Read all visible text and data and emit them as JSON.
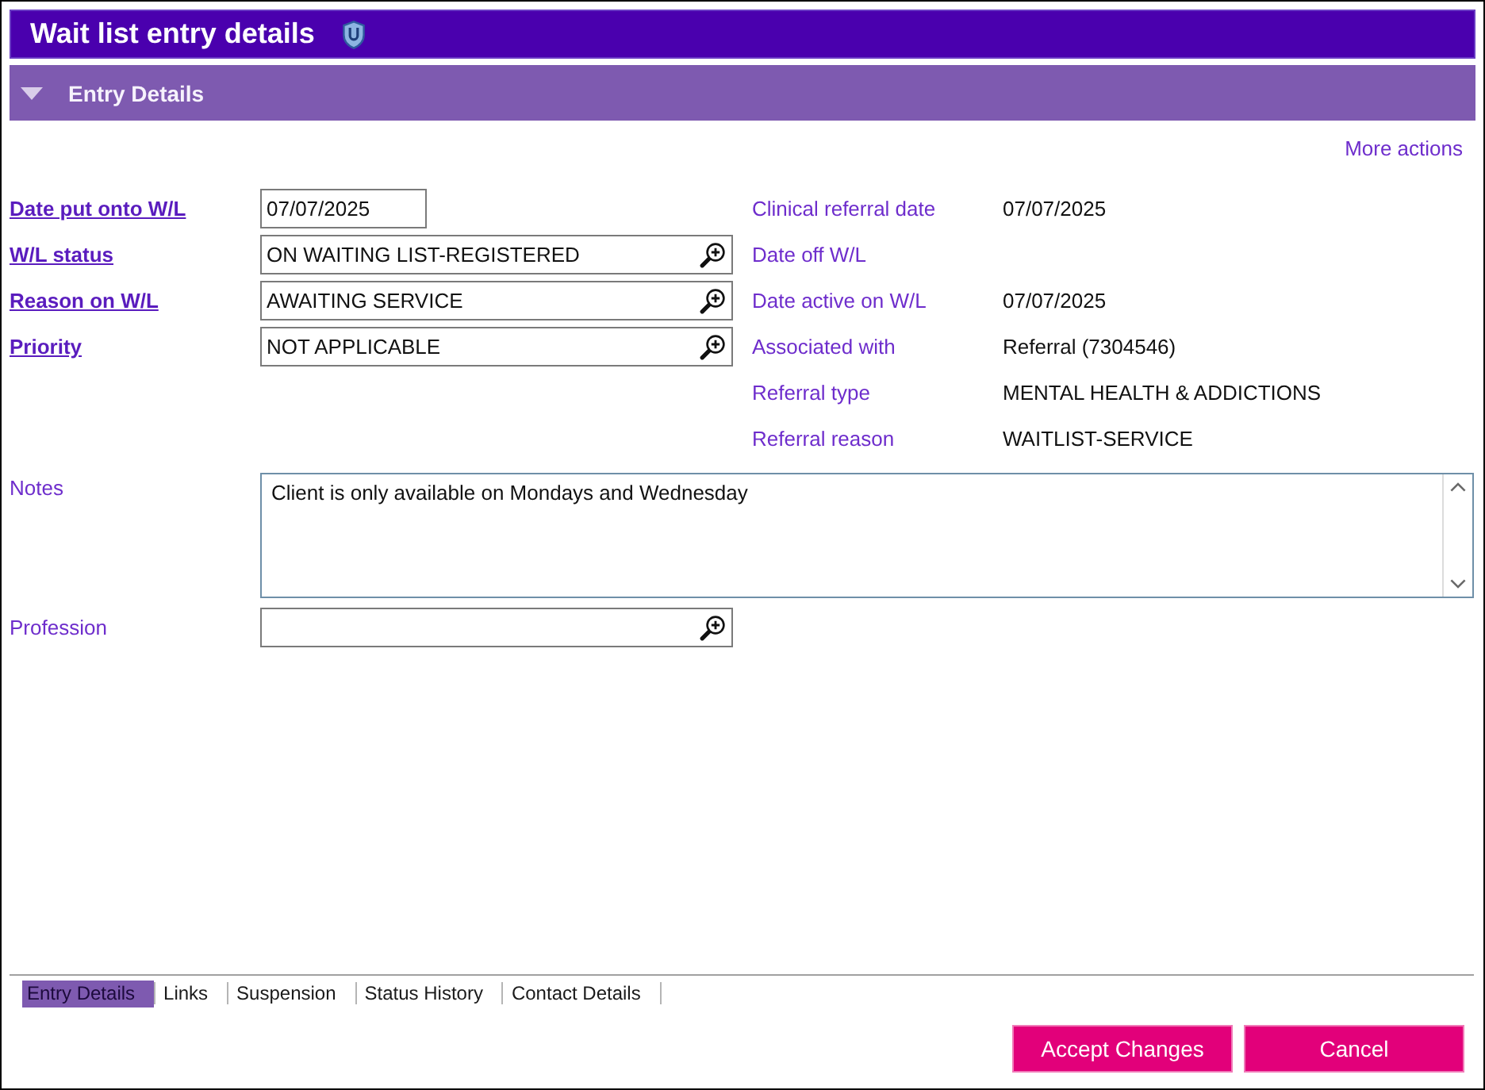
{
  "window": {
    "title": "Wait list entry details"
  },
  "section": {
    "title": "Entry Details",
    "expanded": true
  },
  "more_actions": "More actions",
  "left_fields": [
    {
      "label": "Date put onto W/L",
      "value": "07/07/2025",
      "kind": "date"
    },
    {
      "label": "W/L status",
      "value": "ON WAITING LIST-REGISTERED",
      "kind": "lookup"
    },
    {
      "label": "Reason on W/L",
      "value": "AWAITING SERVICE",
      "kind": "lookup"
    },
    {
      "label": "Priority",
      "value": "NOT APPLICABLE",
      "kind": "lookup"
    }
  ],
  "right_fields": [
    {
      "label": "Clinical referral date",
      "value": "07/07/2025"
    },
    {
      "label": "Date off W/L"
    },
    {
      "label": "Date active on W/L",
      "value": "07/07/2025"
    },
    {
      "label": "Associated with",
      "value": "Referral (7304546)"
    },
    {
      "label": "Referral type",
      "value": "MENTAL HEALTH & ADDICTIONS"
    },
    {
      "label": "Referral reason",
      "value": "WAITLIST-SERVICE"
    }
  ],
  "notes": {
    "label": "Notes",
    "value": "Client is only available on Mondays and Wednesday"
  },
  "profession": {
    "label": "Profession",
    "kind": "lookup"
  },
  "tabs": [
    {
      "label": "Entry Details",
      "selected": true
    },
    {
      "label": "Links",
      "selected": false
    },
    {
      "label": "Suspension",
      "selected": false
    },
    {
      "label": "Status History",
      "selected": false
    },
    {
      "label": "Contact Details",
      "selected": false
    }
  ],
  "buttons": [
    "Accept Changes",
    "Cancel"
  ]
}
